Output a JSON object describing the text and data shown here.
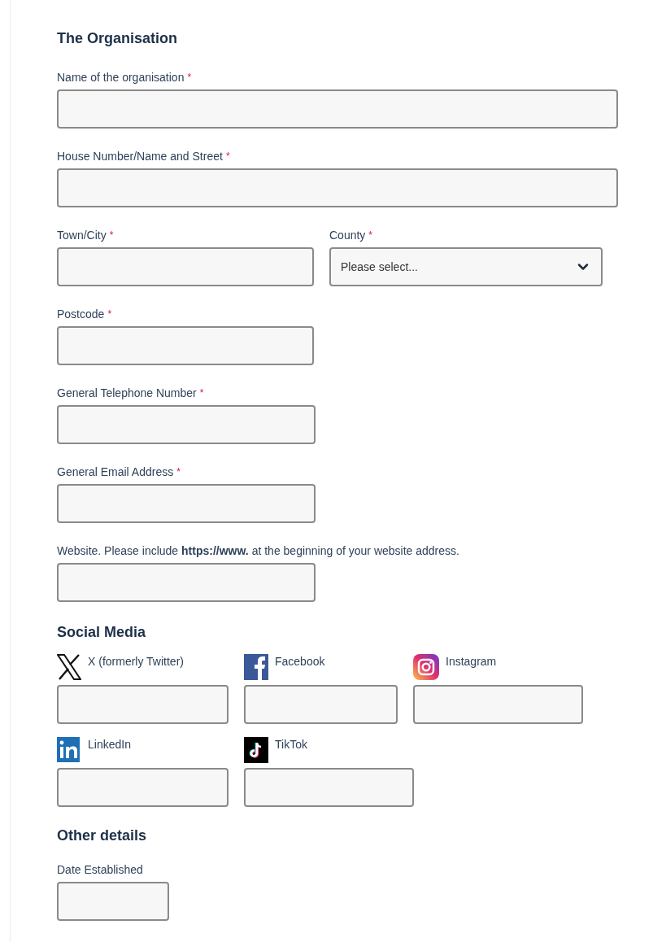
{
  "organisation": {
    "heading": "The Organisation",
    "fields": [
      {
        "label": "Name of the organisation",
        "required_mark": "*",
        "kind": "text"
      },
      {
        "label": "House Number/Name and Street",
        "required_mark": "*",
        "kind": "text"
      },
      {
        "label": "Town/City",
        "required_mark": "*",
        "kind": "text"
      },
      {
        "label": "County",
        "required_mark": "*",
        "kind": "select",
        "value": "Please select..."
      },
      {
        "label": "Postcode",
        "required_mark": "*",
        "kind": "text"
      },
      {
        "label": "General Telephone Number",
        "required_mark": "*",
        "kind": "text"
      },
      {
        "label": "General Email Address",
        "required_mark": "*",
        "kind": "text"
      },
      {
        "label": "Website. Please include **https://www.** at the beginning of your website address.",
        "kind": "text"
      }
    ]
  },
  "social_media": {
    "heading": "Social Media",
    "fields": [
      {
        "label": "X (formerly Twitter)",
        "kind": "x"
      },
      {
        "label": "Facebook",
        "kind": "facebook"
      },
      {
        "label": "Instagram",
        "kind": "instagram"
      },
      {
        "label": "LinkedIn",
        "kind": "linkedin"
      },
      {
        "label": "TikTok",
        "kind": "tiktok"
      }
    ]
  },
  "other_details": {
    "heading": "Other details",
    "fields": [
      {
        "label": "Date Established",
        "kind": "text"
      }
    ]
  }
}
